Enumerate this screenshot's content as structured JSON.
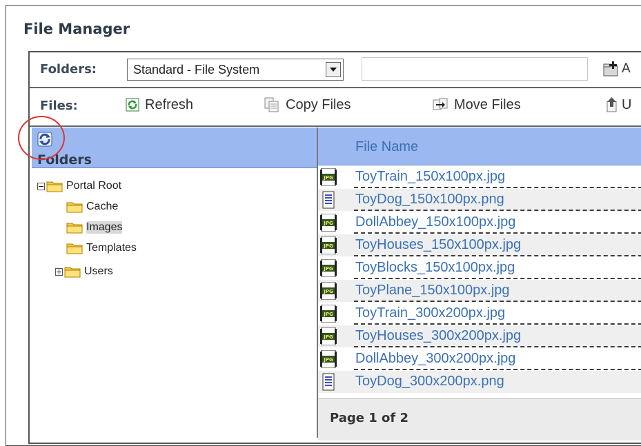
{
  "title": "File Manager",
  "toolbar_folders": {
    "label": "Folders:",
    "select_value": "Standard - File System",
    "path_value": "",
    "add_label": "A"
  },
  "toolbar_files": {
    "label": "Files:",
    "refresh": "Refresh",
    "copy": "Copy Files",
    "move": "Move Files",
    "upload": "U"
  },
  "folders_pane": {
    "header": "Folders",
    "tree": [
      {
        "label": "Portal Root",
        "expander": "minus",
        "level": 0,
        "selected": false
      },
      {
        "label": "Cache",
        "expander": "none",
        "level": 1,
        "selected": false
      },
      {
        "label": "Images",
        "expander": "none",
        "level": 1,
        "selected": true
      },
      {
        "label": "Templates",
        "expander": "none",
        "level": 1,
        "selected": false
      },
      {
        "label": "Users",
        "expander": "plus",
        "level": 1,
        "selected": false
      }
    ]
  },
  "files_pane": {
    "header": "File Name",
    "files": [
      {
        "name": "ToyTrain_150x100px.jpg",
        "icon": "jpg-file-icon"
      },
      {
        "name": "ToyDog_150x100px.png",
        "icon": "png-file-icon"
      },
      {
        "name": "DollAbbey_150x100px.jpg",
        "icon": "jpg-file-icon"
      },
      {
        "name": "ToyHouses_150x100px.jpg",
        "icon": "jpg-file-icon"
      },
      {
        "name": "ToyBlocks_150x100px.jpg",
        "icon": "jpg-file-icon"
      },
      {
        "name": "ToyPlane_150x100px.jpg",
        "icon": "jpg-file-icon"
      },
      {
        "name": "ToyTrain_300x200px.jpg",
        "icon": "jpg-file-icon"
      },
      {
        "name": "ToyHouses_300x200px.jpg",
        "icon": "jpg-file-icon"
      },
      {
        "name": "DollAbbey_300x200px.jpg",
        "icon": "jpg-file-icon"
      },
      {
        "name": "ToyDog_300x200px.png",
        "icon": "png-file-icon"
      }
    ],
    "pager": "Page 1 of 2"
  },
  "colors": {
    "header_blue": "#9bb8f0",
    "link_blue": "#3a72b8",
    "highlight_circle": "#e0322d"
  }
}
